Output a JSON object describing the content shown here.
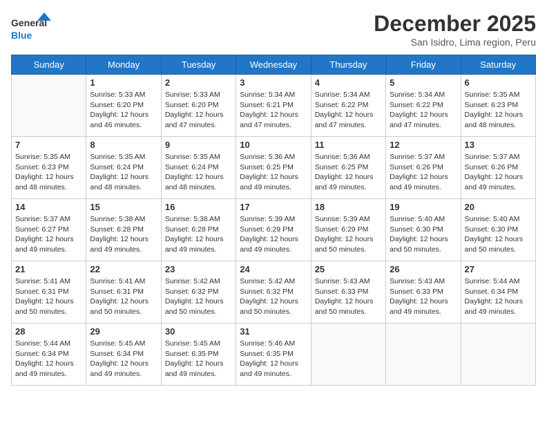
{
  "header": {
    "logo_line1": "General",
    "logo_line2": "Blue",
    "month": "December 2025",
    "location": "San Isidro, Lima region, Peru"
  },
  "days_of_week": [
    "Sunday",
    "Monday",
    "Tuesday",
    "Wednesday",
    "Thursday",
    "Friday",
    "Saturday"
  ],
  "weeks": [
    [
      {
        "day": "",
        "info": ""
      },
      {
        "day": "1",
        "info": "Sunrise: 5:33 AM\nSunset: 6:20 PM\nDaylight: 12 hours\nand 46 minutes."
      },
      {
        "day": "2",
        "info": "Sunrise: 5:33 AM\nSunset: 6:20 PM\nDaylight: 12 hours\nand 47 minutes."
      },
      {
        "day": "3",
        "info": "Sunrise: 5:34 AM\nSunset: 6:21 PM\nDaylight: 12 hours\nand 47 minutes."
      },
      {
        "day": "4",
        "info": "Sunrise: 5:34 AM\nSunset: 6:22 PM\nDaylight: 12 hours\nand 47 minutes."
      },
      {
        "day": "5",
        "info": "Sunrise: 5:34 AM\nSunset: 6:22 PM\nDaylight: 12 hours\nand 47 minutes."
      },
      {
        "day": "6",
        "info": "Sunrise: 5:35 AM\nSunset: 6:23 PM\nDaylight: 12 hours\nand 48 minutes."
      }
    ],
    [
      {
        "day": "7",
        "info": "Sunrise: 5:35 AM\nSunset: 6:23 PM\nDaylight: 12 hours\nand 48 minutes."
      },
      {
        "day": "8",
        "info": "Sunrise: 5:35 AM\nSunset: 6:24 PM\nDaylight: 12 hours\nand 48 minutes."
      },
      {
        "day": "9",
        "info": "Sunrise: 5:35 AM\nSunset: 6:24 PM\nDaylight: 12 hours\nand 48 minutes."
      },
      {
        "day": "10",
        "info": "Sunrise: 5:36 AM\nSunset: 6:25 PM\nDaylight: 12 hours\nand 49 minutes."
      },
      {
        "day": "11",
        "info": "Sunrise: 5:36 AM\nSunset: 6:25 PM\nDaylight: 12 hours\nand 49 minutes."
      },
      {
        "day": "12",
        "info": "Sunrise: 5:37 AM\nSunset: 6:26 PM\nDaylight: 12 hours\nand 49 minutes."
      },
      {
        "day": "13",
        "info": "Sunrise: 5:37 AM\nSunset: 6:26 PM\nDaylight: 12 hours\nand 49 minutes."
      }
    ],
    [
      {
        "day": "14",
        "info": "Sunrise: 5:37 AM\nSunset: 6:27 PM\nDaylight: 12 hours\nand 49 minutes."
      },
      {
        "day": "15",
        "info": "Sunrise: 5:38 AM\nSunset: 6:28 PM\nDaylight: 12 hours\nand 49 minutes."
      },
      {
        "day": "16",
        "info": "Sunrise: 5:38 AM\nSunset: 6:28 PM\nDaylight: 12 hours\nand 49 minutes."
      },
      {
        "day": "17",
        "info": "Sunrise: 5:39 AM\nSunset: 6:29 PM\nDaylight: 12 hours\nand 49 minutes."
      },
      {
        "day": "18",
        "info": "Sunrise: 5:39 AM\nSunset: 6:29 PM\nDaylight: 12 hours\nand 50 minutes."
      },
      {
        "day": "19",
        "info": "Sunrise: 5:40 AM\nSunset: 6:30 PM\nDaylight: 12 hours\nand 50 minutes."
      },
      {
        "day": "20",
        "info": "Sunrise: 5:40 AM\nSunset: 6:30 PM\nDaylight: 12 hours\nand 50 minutes."
      }
    ],
    [
      {
        "day": "21",
        "info": "Sunrise: 5:41 AM\nSunset: 6:31 PM\nDaylight: 12 hours\nand 50 minutes."
      },
      {
        "day": "22",
        "info": "Sunrise: 5:41 AM\nSunset: 6:31 PM\nDaylight: 12 hours\nand 50 minutes."
      },
      {
        "day": "23",
        "info": "Sunrise: 5:42 AM\nSunset: 6:32 PM\nDaylight: 12 hours\nand 50 minutes."
      },
      {
        "day": "24",
        "info": "Sunrise: 5:42 AM\nSunset: 6:32 PM\nDaylight: 12 hours\nand 50 minutes."
      },
      {
        "day": "25",
        "info": "Sunrise: 5:43 AM\nSunset: 6:33 PM\nDaylight: 12 hours\nand 50 minutes."
      },
      {
        "day": "26",
        "info": "Sunrise: 5:43 AM\nSunset: 6:33 PM\nDaylight: 12 hours\nand 49 minutes."
      },
      {
        "day": "27",
        "info": "Sunrise: 5:44 AM\nSunset: 6:34 PM\nDaylight: 12 hours\nand 49 minutes."
      }
    ],
    [
      {
        "day": "28",
        "info": "Sunrise: 5:44 AM\nSunset: 6:34 PM\nDaylight: 12 hours\nand 49 minutes."
      },
      {
        "day": "29",
        "info": "Sunrise: 5:45 AM\nSunset: 6:34 PM\nDaylight: 12 hours\nand 49 minutes."
      },
      {
        "day": "30",
        "info": "Sunrise: 5:45 AM\nSunset: 6:35 PM\nDaylight: 12 hours\nand 49 minutes."
      },
      {
        "day": "31",
        "info": "Sunrise: 5:46 AM\nSunset: 6:35 PM\nDaylight: 12 hours\nand 49 minutes."
      },
      {
        "day": "",
        "info": ""
      },
      {
        "day": "",
        "info": ""
      },
      {
        "day": "",
        "info": ""
      }
    ]
  ]
}
